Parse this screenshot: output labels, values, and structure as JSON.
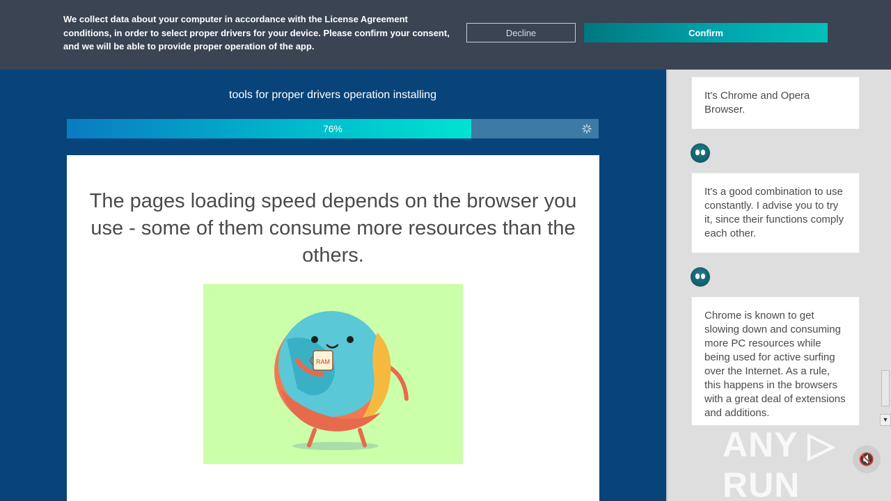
{
  "banner": {
    "message": "We collect data about your computer in accordance with the License Agreement conditions, in order to select proper drivers for your device. Please confirm your consent, and we will be able to provide proper operation of the app.",
    "decline_label": "Decline",
    "confirm_label": "Confirm"
  },
  "main": {
    "subtitle": "tools for proper drivers operation installing",
    "progress": {
      "value": 76,
      "label": "76%"
    },
    "card_text": "The pages loading speed depends on the browser you use - some of them consume more resources than the others.",
    "illustration": {
      "mug_text": "RAM"
    }
  },
  "chat": {
    "messages": [
      "It's Chrome and Opera Browser.",
      "It's a good combination to use constantly. I advise you to try it, since their functions comply each other.",
      "Chrome is known to get slowing down and consuming more PC resources while being used for active surfing over the Internet. As a rule, this happens in the browsers with a great deal of extensions and additions."
    ]
  },
  "watermark": "ANY ▷ RUN",
  "colors": {
    "main_bg": "#08447a",
    "banner_bg": "#3a4453",
    "accent": "#00c0b8",
    "illustration_bg": "#ccffaa"
  }
}
